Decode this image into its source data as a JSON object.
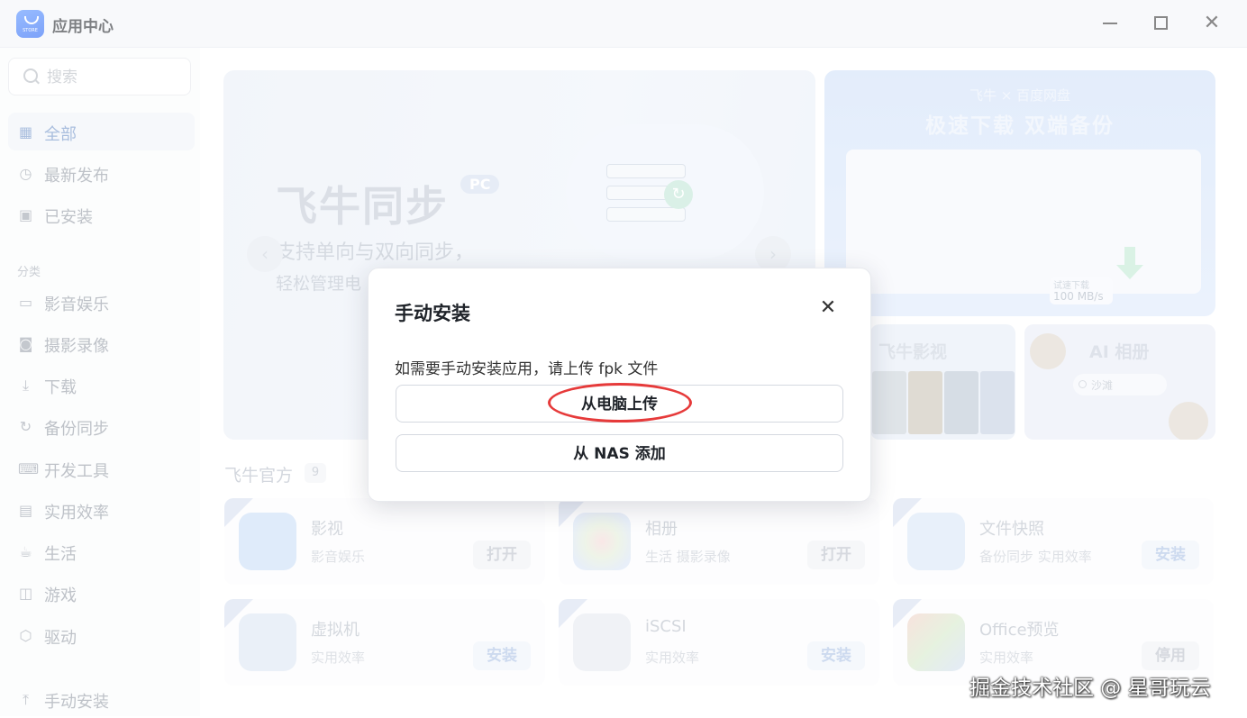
{
  "window": {
    "title": "应用中心",
    "logo_caption": "STORE"
  },
  "sidebar": {
    "search_placeholder": "搜索",
    "items": [
      {
        "label": "全部",
        "icon": "grid-icon"
      },
      {
        "label": "最新发布",
        "icon": "clock-icon"
      },
      {
        "label": "已安装",
        "icon": "installed-icon"
      }
    ],
    "category_label": "分类",
    "categories": [
      {
        "label": "影音娱乐",
        "icon": "video-icon"
      },
      {
        "label": "摄影录像",
        "icon": "camera-icon"
      },
      {
        "label": "下载",
        "icon": "download-icon"
      },
      {
        "label": "备份同步",
        "icon": "sync-icon"
      },
      {
        "label": "开发工具",
        "icon": "code-icon"
      },
      {
        "label": "实用效率",
        "icon": "toolbox-icon"
      },
      {
        "label": "生活",
        "icon": "cup-icon"
      },
      {
        "label": "游戏",
        "icon": "gamepad-icon"
      },
      {
        "label": "驱动",
        "icon": "cube-icon"
      }
    ],
    "manual_install": "手动安装"
  },
  "banners": {
    "main": {
      "title": "飞牛同步",
      "badge": "PC",
      "line1": "支持单向与双向同步，",
      "line2": "轻松管理电"
    },
    "baidu": {
      "top": "飞牛 × 百度网盘",
      "title": "极速下载 双端备份",
      "speed_label": "试速下载",
      "speed_value": "100 MB/s"
    },
    "movies": {
      "title": "飞牛影视"
    },
    "album": {
      "title": "AI 相册",
      "search_text": "沙滩"
    }
  },
  "section": {
    "title": "飞牛官方",
    "count": "9"
  },
  "apps": [
    {
      "name": "影视",
      "tags": "影音娱乐",
      "action": "打开"
    },
    {
      "name": "相册",
      "tags": "生活 摄影录像",
      "action": "打开"
    },
    {
      "name": "文件快照",
      "tags": "备份同步 实用效率",
      "action": "安装"
    },
    {
      "name": "虚拟机",
      "tags": "实用效率",
      "action": "安装"
    },
    {
      "name": "iSCSI",
      "tags": "实用效率",
      "action": "安装"
    },
    {
      "name": "Office预览",
      "tags": "实用效率",
      "action": "停用"
    }
  ],
  "dialog": {
    "title": "手动安装",
    "description": "如需要手动安装应用，请上传 fpk 文件",
    "upload_pc": "从电脑上传",
    "add_nas": "从 NAS 添加"
  },
  "watermark": "掘金技术社区 @ 星哥玩云",
  "colors": {
    "accent": "#1f5ff5",
    "highlight": "#e63a3a"
  }
}
